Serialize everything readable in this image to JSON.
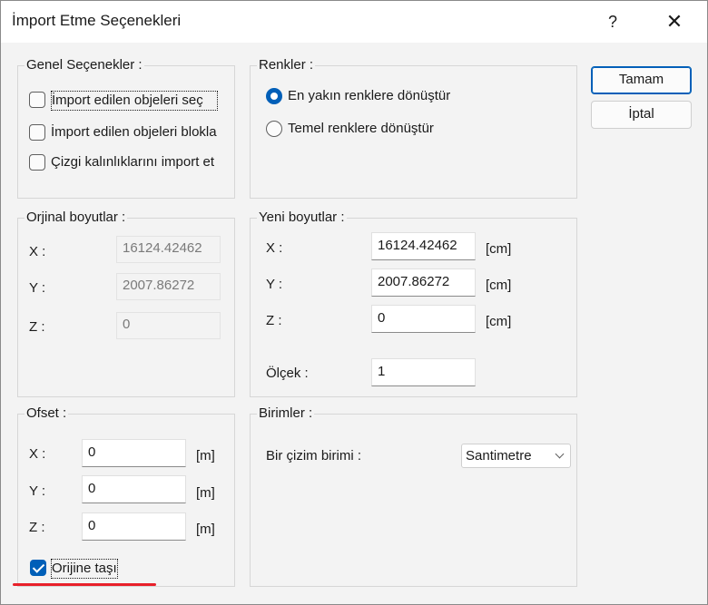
{
  "window": {
    "title": "İmport Etme Seçenekleri",
    "help_glyph": "?",
    "close_glyph": "✕"
  },
  "general": {
    "legend": "Genel Seçenekler :",
    "options": [
      {
        "label": "İmport edilen objeleri seç",
        "checked": false
      },
      {
        "label": "İmport edilen objeleri blokla",
        "checked": false
      },
      {
        "label": "Çizgi kalınlıklarını import et",
        "checked": false
      }
    ]
  },
  "colors": {
    "legend": "Renkler :",
    "options": [
      {
        "label": "En yakın renklere dönüştür",
        "selected": true
      },
      {
        "label": "Temel renklere dönüştür",
        "selected": false
      }
    ]
  },
  "buttons": {
    "ok": "Tamam",
    "cancel": "İptal"
  },
  "original": {
    "legend": "Orjinal boyutlar :",
    "x_label": "X :",
    "x_value": "16124.42462",
    "y_label": "Y :",
    "y_value": "2007.86272",
    "z_label": "Z :",
    "z_value": "0"
  },
  "new": {
    "legend": "Yeni boyutlar :",
    "x_label": "X :",
    "x_value": "16124.42462",
    "y_label": "Y :",
    "y_value": "2007.86272",
    "z_label": "Z :",
    "z_value": "0",
    "unit": "[cm]",
    "scale_label": "Ölçek :",
    "scale_value": "1"
  },
  "offset": {
    "legend": "Ofset :",
    "x_label": "X :",
    "x_value": "0",
    "y_label": "Y :",
    "y_value": "0",
    "z_label": "Z :",
    "z_value": "0",
    "unit": "[m]",
    "move_to_origin": {
      "label": "Orijine taşı",
      "checked": true
    }
  },
  "units": {
    "legend": "Birimler :",
    "drawing_unit_label": "Bir çizim birimi :",
    "drawing_unit_value": "Santimetre"
  },
  "accent_color": "#005fb8",
  "highlight_color": "#e8202a"
}
